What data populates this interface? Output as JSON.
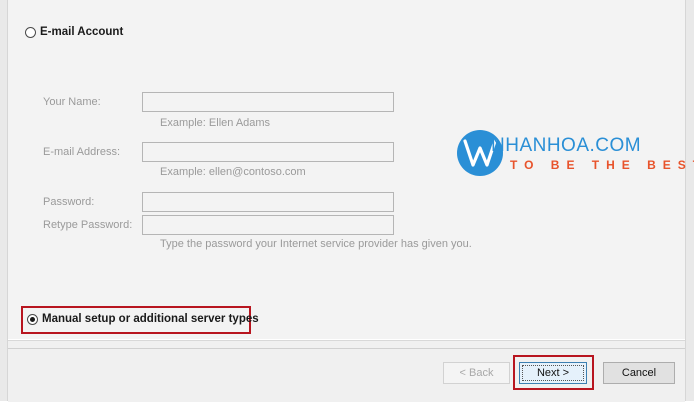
{
  "options": {
    "email_account": {
      "label": "E-mail Account",
      "selected": false
    },
    "manual_setup": {
      "label": "Manual setup or additional server types",
      "selected": true
    }
  },
  "form": {
    "your_name": {
      "label": "Your Name:",
      "value": "",
      "hint": "Example: Ellen Adams"
    },
    "email_address": {
      "label": "E-mail Address:",
      "value": "",
      "hint": "Example: ellen@contoso.com"
    },
    "password": {
      "label": "Password:",
      "value": ""
    },
    "retype_password": {
      "label": "Retype Password:",
      "value": ""
    },
    "password_hint": "Type the password your Internet service provider has given you."
  },
  "watermark": {
    "name": "NHANHOA.COM",
    "tagline": "TO BE THE BEST",
    "name_color": "#2a8fd6",
    "tagline_color": "#e8532b"
  },
  "buttons": {
    "back": "< Back",
    "next": "Next >",
    "cancel": "Cancel"
  },
  "colors": {
    "highlight": "#b8151f"
  }
}
